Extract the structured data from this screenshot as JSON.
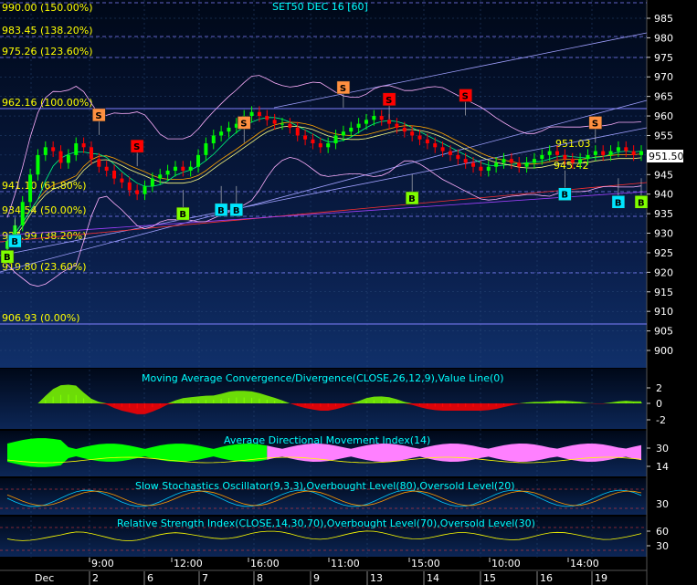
{
  "title": "SET50 DEC 16  [60]",
  "last_price_tag": "951.50",
  "colors": {
    "background": "#0a1a3a",
    "grid": "#2a4a7a",
    "fib_line": "#8080ff",
    "fib_text": "#ffff00",
    "axis_text": "#ffffff",
    "candle_up": "#00ff00",
    "candle_down": "#ff0000",
    "macd_pos": "#7fff00",
    "macd_neg": "#ff0000",
    "adx_green": "#00ff00",
    "adx_pink": "#ff80ff",
    "title_text": "#00ffff",
    "buy_badge": "#7fff00",
    "buy_badge_cyan": "#00e5ff",
    "sell_badge": "#ff9040",
    "sell_badge_red": "#ff0000"
  },
  "chart_data": [
    {
      "panel": "price",
      "type": "candlestick",
      "title": "SET50 DEC 16  [60]",
      "ylim": [
        895,
        990
      ],
      "y_ticks": [
        985,
        980,
        975,
        970,
        965,
        960,
        955,
        950,
        945,
        940,
        935,
        930,
        925,
        920,
        915,
        910,
        905,
        900
      ],
      "fibonacci_levels": [
        {
          "price": 990.0,
          "label": "990.00 (150.00%)"
        },
        {
          "price": 983.45,
          "label": "983.45 (138.20%)"
        },
        {
          "price": 975.26,
          "label": "975.26 (123.60%)"
        },
        {
          "price": 962.16,
          "label": "962.16 (100.00%)"
        },
        {
          "price": 941.1,
          "label": "941.10 (61.80%)"
        },
        {
          "price": 934.54,
          "label": "934.54 (50.00%)"
        },
        {
          "price": 927.99,
          "label": "927.99 (38.20%)"
        },
        {
          "price": 919.8,
          "label": "919.80 (23.60%)"
        },
        {
          "price": 906.93,
          "label": "906.93 (0.00%)"
        }
      ],
      "price_annotations": [
        {
          "label": "951.03",
          "price": 951.03
        },
        {
          "label": "945.42",
          "price": 945.42
        }
      ],
      "last_price": 951.5,
      "close": [
        928,
        932,
        938,
        945,
        950,
        952,
        951,
        948,
        950,
        953,
        952,
        949,
        947,
        946,
        944,
        943,
        941,
        940,
        942,
        944,
        945,
        946,
        947,
        946,
        947,
        950,
        953,
        955,
        956,
        957,
        958,
        960,
        961,
        960,
        959,
        958,
        958,
        957,
        955,
        954,
        953,
        952,
        953,
        955,
        956,
        957,
        958,
        959,
        960,
        959,
        958,
        957,
        956,
        955,
        954,
        953,
        952,
        951,
        950,
        949,
        948,
        947,
        946,
        947,
        948,
        949,
        948,
        947,
        948,
        949,
        950,
        951,
        950,
        949,
        948,
        949,
        950,
        951,
        950,
        951,
        952,
        951,
        950,
        951
      ],
      "signals": [
        {
          "type": "B",
          "index": 0,
          "price": 924
        },
        {
          "type": "B",
          "index": 1,
          "price": 928
        },
        {
          "type": "S",
          "index": 12,
          "price": 957
        },
        {
          "type": "S",
          "index": 17,
          "price": 949
        },
        {
          "type": "B",
          "index": 23,
          "price": 935
        },
        {
          "type": "B",
          "index": 28,
          "price": 936
        },
        {
          "type": "B",
          "index": 30,
          "price": 936
        },
        {
          "type": "S",
          "index": 31,
          "price": 955
        },
        {
          "type": "S",
          "index": 44,
          "price": 964
        },
        {
          "type": "S",
          "index": 50,
          "price": 961
        },
        {
          "type": "B",
          "index": 53,
          "price": 939
        },
        {
          "type": "S",
          "index": 60,
          "price": 962
        },
        {
          "type": "B",
          "index": 73,
          "price": 940
        },
        {
          "type": "S",
          "index": 77,
          "price": 955
        },
        {
          "type": "B",
          "index": 80,
          "price": 938
        },
        {
          "type": "B",
          "index": 83,
          "price": 938
        }
      ]
    },
    {
      "panel": "macd",
      "type": "area",
      "title": "Moving Average Convergence/Divergence(CLOSE,26,12,9),Value Line(0)",
      "y_ticks": [
        2,
        0,
        -2
      ]
    },
    {
      "panel": "adx",
      "type": "area",
      "title": "Average Directional Movement Index(14)",
      "y_ticks": [
        30,
        14
      ]
    },
    {
      "panel": "stochastic",
      "type": "line",
      "title": "Slow Stochastics Oscillator(9,3,3),Overbought Level(80),Oversold Level(20)",
      "y_ticks": [
        30
      ]
    },
    {
      "panel": "rsi",
      "type": "line",
      "title": "Relative Strength Index(CLOSE,14,30,70),Overbought Level(70),Oversold Level(30)",
      "y_ticks": [
        60,
        30
      ]
    }
  ],
  "time_axis": {
    "times": [
      "9:00",
      "12:00",
      "16:00",
      "11:00",
      "15:00",
      "10:00",
      "14:00"
    ],
    "month": "Dec",
    "days": [
      "2",
      "6",
      "7",
      "8",
      "9",
      "13",
      "14",
      "15",
      "16",
      "19"
    ]
  }
}
